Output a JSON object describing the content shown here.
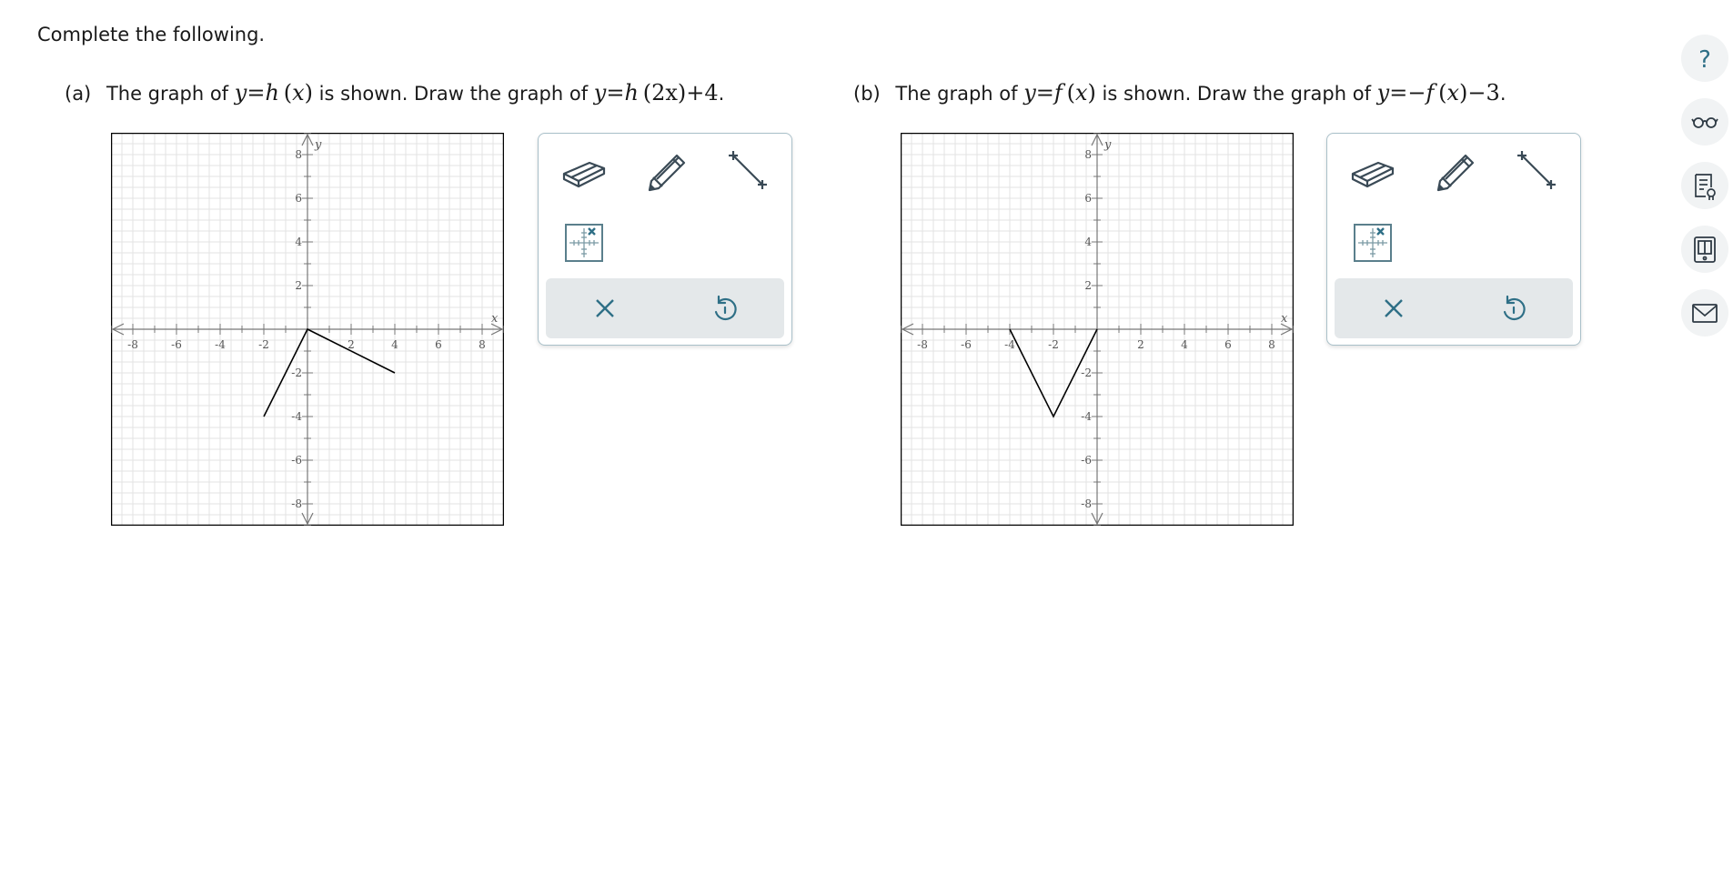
{
  "instruction": "Complete the following.",
  "problems": [
    {
      "id": "a",
      "marker": "(a)",
      "text1": "The graph of",
      "given_eq": {
        "lhs": "y",
        "eq": "=",
        "fn": "h",
        "arg": "x"
      },
      "text2": "is shown. Draw the graph of",
      "target_eq": {
        "lhs": "y",
        "eq": "=",
        "fn": "h",
        "arg": "2x",
        "tail": "+4",
        "end": "."
      },
      "graph": {
        "xlim": [
          -9,
          9
        ],
        "ylim": [
          -9,
          9
        ],
        "x_ticks": [
          "-8",
          "-6",
          "-4",
          "-2",
          "2",
          "4",
          "6",
          "8"
        ],
        "y_ticks": [
          "8",
          "6",
          "4",
          "2",
          "-2",
          "-4",
          "-6",
          "-8"
        ],
        "x_axis_label": "x",
        "y_axis_label": "y",
        "polyline": [
          [
            -2,
            -4
          ],
          [
            0,
            0
          ],
          [
            4,
            -2
          ]
        ]
      }
    },
    {
      "id": "b",
      "marker": "(b)",
      "text1": "The graph of",
      "given_eq": {
        "lhs": "y",
        "eq": "=",
        "fn": "f",
        "arg": "x"
      },
      "text2": "is shown. Draw the graph of",
      "target_eq": {
        "lhs": "y",
        "eq": "=",
        "fn": "−f",
        "arg": "x",
        "tail": "−3",
        "end": "."
      },
      "graph": {
        "xlim": [
          -9,
          9
        ],
        "ylim": [
          -9,
          9
        ],
        "x_ticks": [
          "-8",
          "-6",
          "-4",
          "-2",
          "2",
          "4",
          "6",
          "8"
        ],
        "y_ticks": [
          "8",
          "6",
          "4",
          "2",
          "-2",
          "-4",
          "-6",
          "-8"
        ],
        "x_axis_label": "x",
        "y_axis_label": "y",
        "polyline": [
          [
            -4,
            0
          ],
          [
            -2,
            -4
          ],
          [
            0,
            0
          ]
        ]
      }
    }
  ],
  "toolbox_tools": [
    "eraser-icon",
    "pencil-icon",
    "line-segment-icon",
    "graph-settings-icon"
  ],
  "toolbox_actions": [
    "clear-icon",
    "undo-icon"
  ],
  "sidebar_icons": [
    "help-icon",
    "accessibility-glasses-icon",
    "notes-icon",
    "ebook-icon",
    "message-icon"
  ],
  "colors": {
    "accent": "#2e6f86",
    "tool": "#3a4a56",
    "axis": "#777777",
    "grid": "#e3e3e3",
    "curve": "#000000"
  }
}
